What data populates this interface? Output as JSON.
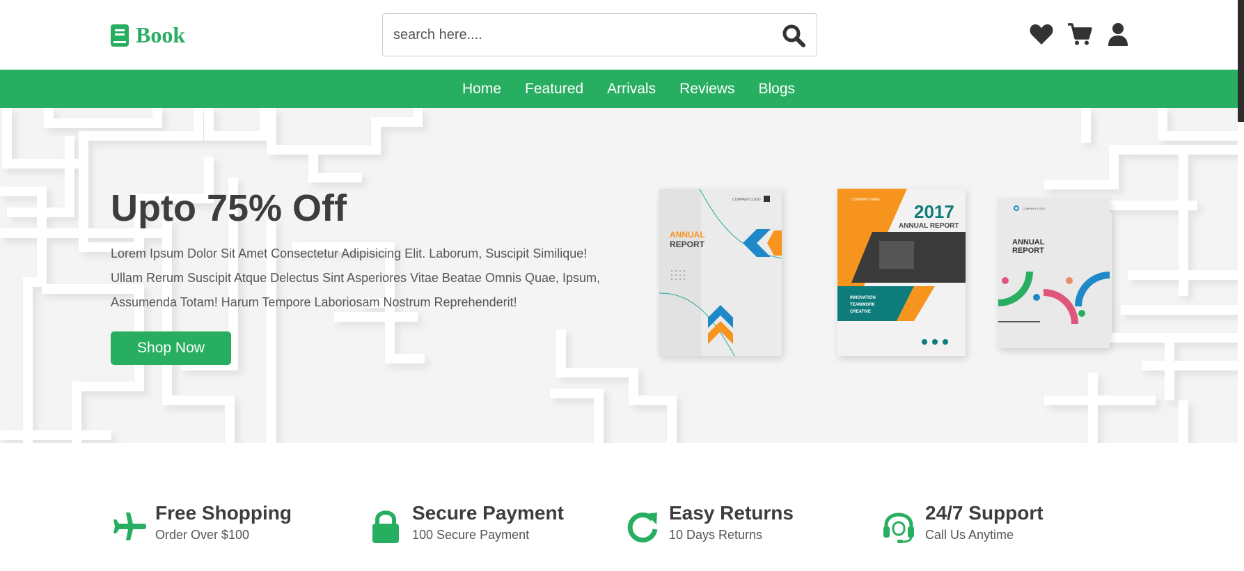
{
  "header": {
    "logo_text": "Book",
    "search_placeholder": "search here...."
  },
  "nav": {
    "links": [
      "Home",
      "Featured",
      "Arrivals",
      "Reviews",
      "Blogs"
    ]
  },
  "hero": {
    "title": "Upto 75% Off",
    "description": "Lorem Ipsum Dolor Sit Amet Consectetur Adipisicing Elit. Laborum, Suscipit Similique! Ullam Rerum Suscipit Atque Delectus Sint Asperiores Vitae Beatae Omnis Quae, Ipsum, Assumenda Totam! Harum Tempore Laboriosam Nostrum Reprehenderit!",
    "button": "Shop Now",
    "books": [
      {
        "top_text": "COMPANY LOGO",
        "title_1": "ANNUAL",
        "title_2": "REPORT"
      },
      {
        "year": "2017",
        "heading": "ANNUAL REPORT",
        "tagline_1": "INNOVATION",
        "tagline_2": "TEAMWORK",
        "tagline_3": "CREATIVE",
        "logo": "COMPANY NAME"
      },
      {
        "top_text": "COMPANY LOGO",
        "title_1": "ANNUAL",
        "title_2": "REPORT"
      }
    ]
  },
  "features": [
    {
      "icon": "plane-icon",
      "title": "Free Shopping",
      "subtitle": "Order Over $100"
    },
    {
      "icon": "lock-icon",
      "title": "Secure Payment",
      "subtitle": "100 Secure Payment"
    },
    {
      "icon": "redo-icon",
      "title": "Easy Returns",
      "subtitle": "10 Days Returns"
    },
    {
      "icon": "headset-icon",
      "title": "24/7 Support",
      "subtitle": "Call Us Anytime"
    }
  ],
  "colors": {
    "accent": "#27ae60",
    "text_dark": "#3d3d3d",
    "book_orange": "#f7941d",
    "book_blue": "#1e88c8",
    "book_teal": "#0e7c7b"
  }
}
